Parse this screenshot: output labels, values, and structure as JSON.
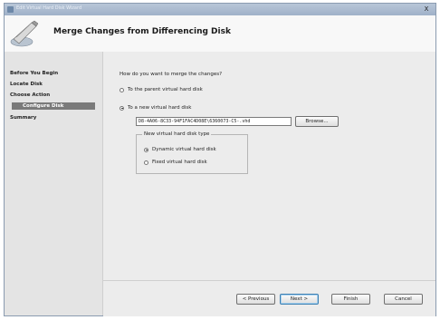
{
  "window": {
    "title": "Edit Virtual Hard Disk Wizard",
    "close_label": "X"
  },
  "header": {
    "title": "Merge Changes from Differencing Disk",
    "icon": "wizard-disk-icon"
  },
  "sidebar": {
    "items": [
      {
        "label": "Before You Begin"
      },
      {
        "label": "Locate Disk"
      },
      {
        "label": "Choose Action"
      },
      {
        "label": "Configure Disk"
      },
      {
        "label": "Summary"
      }
    ]
  },
  "main": {
    "question": "How do you want to merge the changes?",
    "option_parent": "To the parent virtual hard disk",
    "option_new": "To a new virtual hard disk",
    "path_value": "D8-4A06-8C33-94F1FAC4D08E\\6360073-C5-.vhd",
    "browse_label": "Browse...",
    "disk_type_legend": "New virtual hard disk type",
    "option_dynamic": "Dynamic virtual hard disk",
    "option_fixed": "Fixed virtual hard disk"
  },
  "footer": {
    "previous_label": "< Previous",
    "next_label": "Next >",
    "finish_label": "Finish",
    "cancel_label": "Cancel"
  }
}
